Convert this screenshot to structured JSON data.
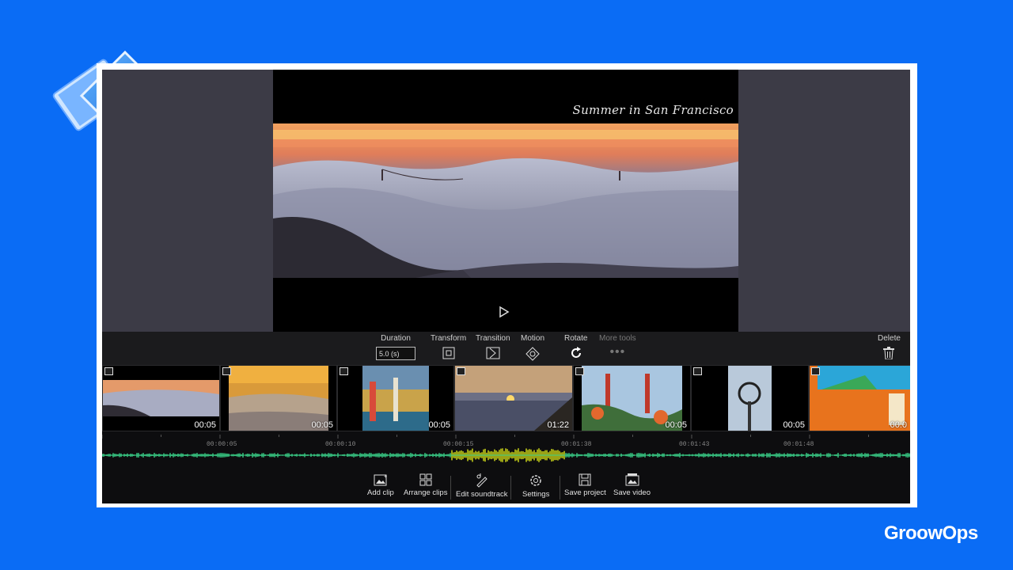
{
  "video": {
    "title": "Summer in San Francisco"
  },
  "toolbar": {
    "duration_label": "Duration",
    "duration_value": "5.0 (s)",
    "transform_label": "Transform",
    "transition_label": "Transition",
    "motion_label": "Motion",
    "rotate_label": "Rotate",
    "more_tools_label": "More tools",
    "delete_label": "Delete"
  },
  "clips": [
    {
      "type": "photo",
      "time": "00:05"
    },
    {
      "type": "photo",
      "time": "00:05"
    },
    {
      "type": "photo",
      "time": "00:05"
    },
    {
      "type": "video",
      "time": "01:22"
    },
    {
      "type": "photo",
      "time": "00:05"
    },
    {
      "type": "photo",
      "time": "00:05"
    },
    {
      "type": "photo",
      "time": "00:0"
    }
  ],
  "timeline": {
    "ticks": [
      "00:00:05",
      "00:00:10",
      "00:00:15",
      "00:01:38",
      "00:01:43",
      "00:01:48"
    ]
  },
  "bottom_bar": {
    "add_clip": "Add clip",
    "arrange_clips": "Arrange clips",
    "edit_soundtrack": "Edit soundtrack",
    "settings": "Settings",
    "save_project": "Save project",
    "save_video": "Save video"
  },
  "brand": "GroowOps",
  "colors": {
    "background": "#0a6cf5",
    "panel": "#3c3b46",
    "waveform": "#3ad38a",
    "waveform_highlight": "#d8e21a"
  }
}
